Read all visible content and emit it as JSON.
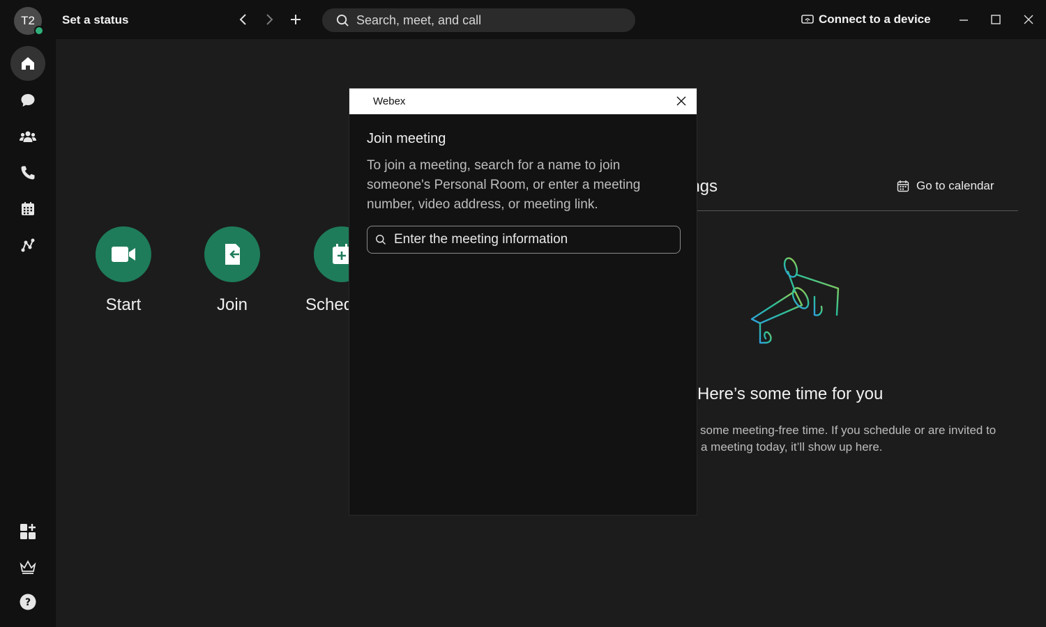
{
  "header": {
    "avatar_initials": "T2",
    "status": "Set a status",
    "search_placeholder": "Search, meet, and call",
    "connect_label": "Connect to a device"
  },
  "actions": [
    {
      "label": "Start",
      "icon": "video-icon"
    },
    {
      "label": "Join",
      "icon": "join-icon"
    },
    {
      "label": "Sched",
      "icon": "calendar-add-icon"
    }
  ],
  "meetings": {
    "title_partial": "ings",
    "calendar_link": "Go to calendar",
    "empty_title": "Here’s some time for you",
    "empty_desc_line1": "some meeting-free time. If you schedule or are invited to",
    "empty_desc_line2": "a meeting today, it’ll show up here."
  },
  "dialog": {
    "window_title": "Webex",
    "heading": "Join meeting",
    "description": "To join a meeting, search for a name to join someone's Personal Room, or enter a meeting number, video address, or meeting link.",
    "input_placeholder": "Enter the meeting information"
  },
  "colors": {
    "accent_green": "#1e7c5a",
    "presence_green": "#2fb07a"
  }
}
